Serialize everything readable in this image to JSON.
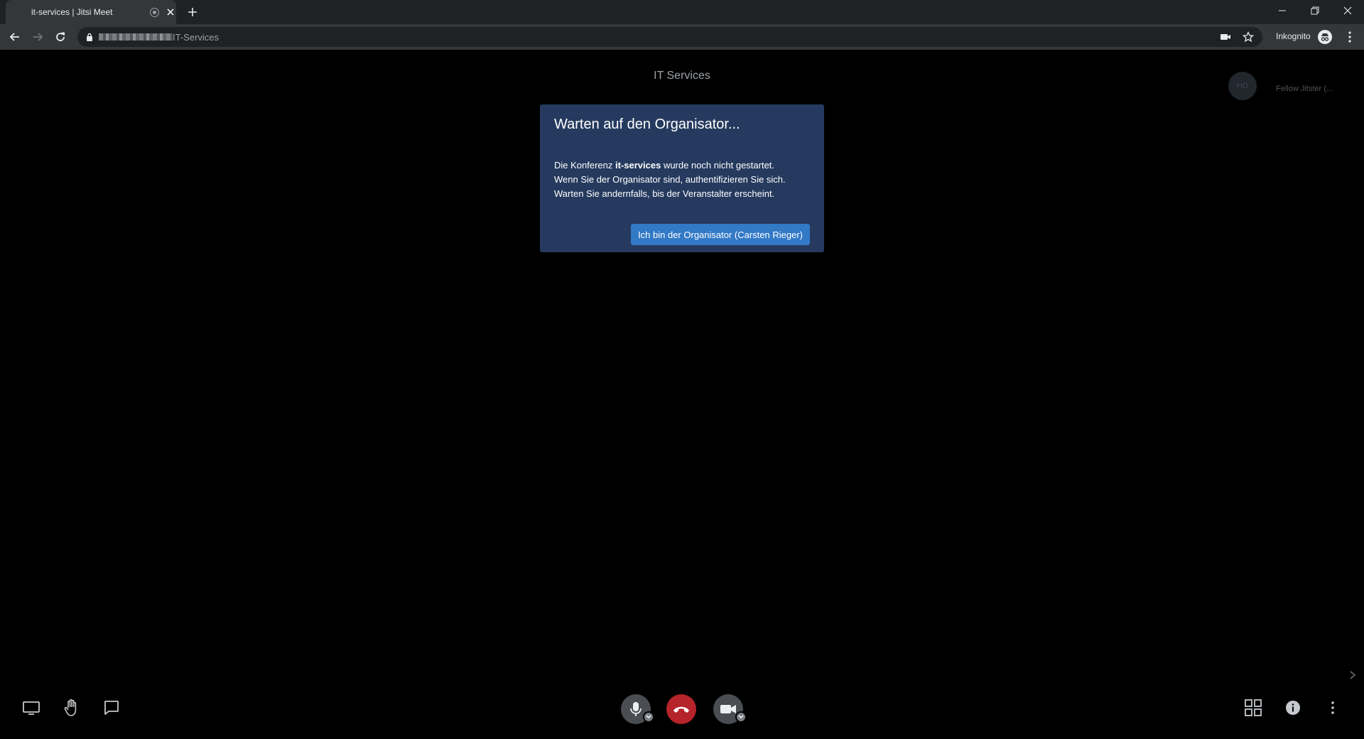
{
  "browser": {
    "tab_title": "it-services | Jitsi Meet",
    "url_path": "IT-Services",
    "profile_label": "Inkognito"
  },
  "meeting": {
    "room_title": "IT Services",
    "remote_participant": {
      "initials": "HD",
      "name": "Fellow Jitster (..."
    }
  },
  "dialog": {
    "title": "Warten auf den Organisator...",
    "body_prefix": "Die Konferenz ",
    "room_name": "it-services",
    "body_suffix": " wurde noch nicht gestartet.",
    "line2": "Wenn Sie der Organisator sind, authentifizieren Sie sich.",
    "line3": "Warten Sie andernfalls, bis der Veranstalter erscheint.",
    "button_label": "Ich bin der Organisator (Carsten Rieger)"
  },
  "colors": {
    "dialog_bg": "#253a5e",
    "primary_button": "#3279c6",
    "hangup": "#b6242b"
  }
}
